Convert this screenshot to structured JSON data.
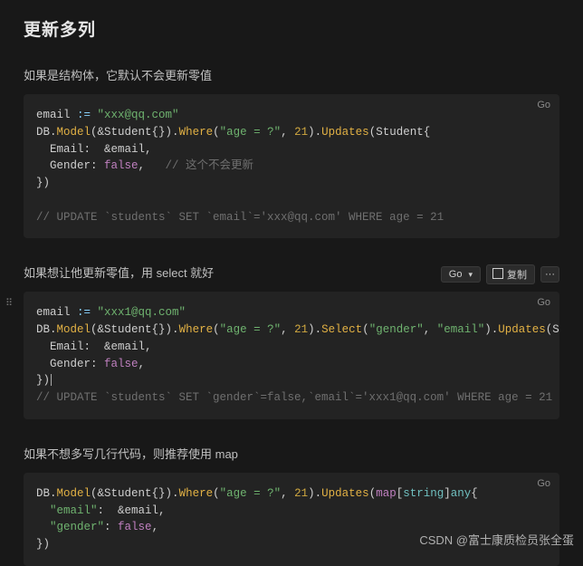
{
  "title": "更新多列",
  "sections": [
    {
      "text": "如果是结构体，它默认不会更新零值"
    },
    {
      "text": "如果想让他更新零值，用 select 就好"
    },
    {
      "text": "如果不想多写几行代码，则推荐使用 map"
    }
  ],
  "codeblocks": {
    "lang": "Go",
    "block1": {
      "email_assign_l": "email ",
      "op_assign": ":=",
      "email_val": "\"xxx@qq.com\"",
      "db": "DB",
      "model": "Model",
      "student_arg": "(&Student{}).",
      "where": "Where",
      "where_args_a": "(",
      "where_str": "\"age = ?\"",
      "where_args_b": ", ",
      "where_num": "21",
      "where_args_c": ").",
      "updates": "Updates",
      "updates_open": "(Student{",
      "field_email": "  Email:  &email,",
      "field_gender_l": "  Gender: ",
      "false": "false",
      "field_gender_r": ",   ",
      "inline_cmt": "// 这个不会更新",
      "close": "})",
      "sql_cmt": "// UPDATE `students` SET `email`='xxx@qq.com' WHERE age = 21"
    },
    "block2": {
      "email_assign_l": "email ",
      "op_assign": ":=",
      "email_val": "\"xxx1@qq.com\"",
      "db": "DB",
      "model": "Model",
      "student_arg": "(&Student{}).",
      "where": "Where",
      "where_args_a": "(",
      "where_str": "\"age = ?\"",
      "where_args_b": ", ",
      "where_num": "21",
      "where_args_c": ").",
      "select": "Select",
      "select_args_a": "(",
      "select_s1": "\"gender\"",
      "select_args_b": ", ",
      "select_s2": "\"email\"",
      "select_args_c": ").",
      "updates": "Updates",
      "updates_open": "(Student{",
      "field_email": "  Email:  &email,",
      "field_gender_l": "  Gender: ",
      "false": "false",
      "field_gender_r": ",",
      "close": "})",
      "sql_cmt": "// UPDATE `students` SET `gender`=false,`email`='xxx1@qq.com' WHERE age = 21"
    },
    "block3": {
      "db": "DB",
      "model": "Model",
      "student_arg": "(&Student{}).",
      "where": "Where",
      "where_args_a": "(",
      "where_str": "\"age = ?\"",
      "where_args_b": ", ",
      "where_num": "21",
      "where_args_c": ").",
      "updates": "Updates",
      "updates_open_a": "(",
      "map_kw": "map",
      "updates_open_b": "[",
      "string_kw": "string",
      "updates_open_c": "]",
      "any_kw": "any",
      "updates_open_d": "{",
      "row_email_l": "  ",
      "row_email_key": "\"email\"",
      "row_email_r": ":  &email,",
      "row_gender_l": "  ",
      "row_gender_key": "\"gender\"",
      "row_gender_mid": ": ",
      "false": "false",
      "row_gender_r": ",",
      "close": "})"
    }
  },
  "toolbar": {
    "go_label": "Go",
    "copy_label": "复制",
    "more_label": "···"
  },
  "watermark": "CSDN @富士康质检员张全蛋"
}
